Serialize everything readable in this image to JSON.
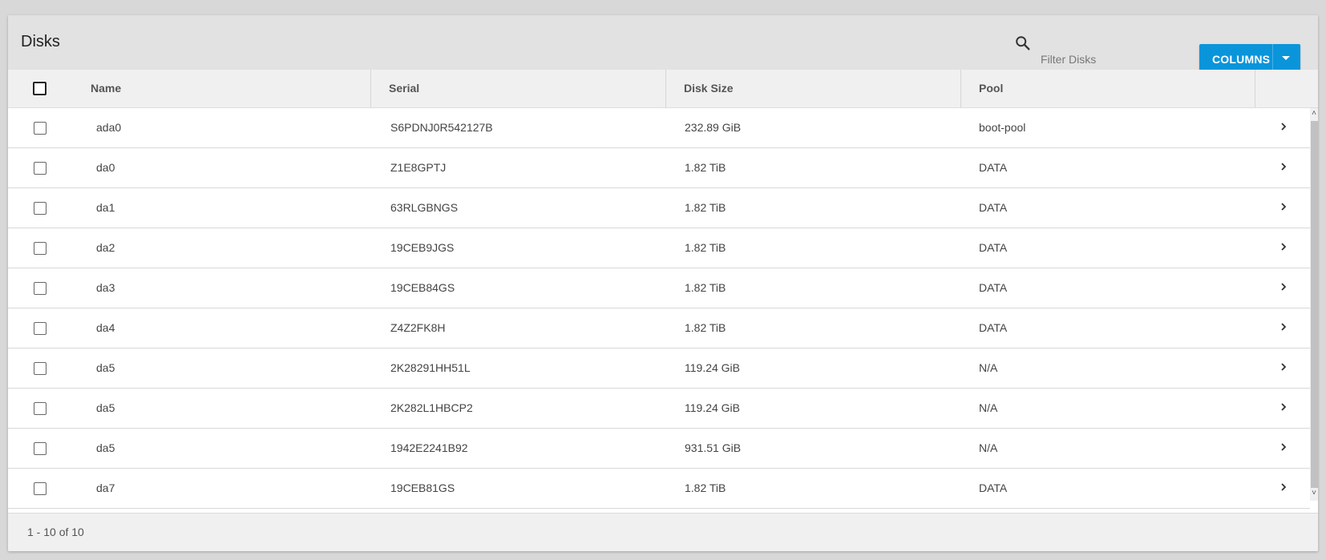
{
  "toolbar": {
    "title": "Disks",
    "search_icon": "search-icon",
    "filter_placeholder": "Filter Disks",
    "filter_value": "",
    "columns_label": "COLUMNS",
    "columns_caret_icon": "caret-down-icon",
    "accent_color": "#0a95db"
  },
  "table": {
    "headers": {
      "name": "Name",
      "serial": "Serial",
      "disk_size": "Disk Size",
      "pool": "Pool"
    },
    "rows": [
      {
        "name": "ada0",
        "serial": "S6PDNJ0R542127B",
        "disk_size": "232.89 GiB",
        "pool": "boot-pool"
      },
      {
        "name": "da0",
        "serial": "Z1E8GPTJ",
        "disk_size": "1.82 TiB",
        "pool": "DATA"
      },
      {
        "name": "da1",
        "serial": "63RLGBNGS",
        "disk_size": "1.82 TiB",
        "pool": "DATA"
      },
      {
        "name": "da2",
        "serial": "19CEB9JGS",
        "disk_size": "1.82 TiB",
        "pool": "DATA"
      },
      {
        "name": "da3",
        "serial": "19CEB84GS",
        "disk_size": "1.82 TiB",
        "pool": "DATA"
      },
      {
        "name": "da4",
        "serial": "Z4Z2FK8H",
        "disk_size": "1.82 TiB",
        "pool": "DATA"
      },
      {
        "name": "da5",
        "serial": "2K28291HH51L",
        "disk_size": "119.24 GiB",
        "pool": "N/A"
      },
      {
        "name": "da5",
        "serial": "2K282L1HBCP2",
        "disk_size": "119.24 GiB",
        "pool": "N/A"
      },
      {
        "name": "da5",
        "serial": "1942E2241B92",
        "disk_size": "931.51 GiB",
        "pool": "N/A"
      },
      {
        "name": "da7",
        "serial": "19CEB81GS",
        "disk_size": "1.82 TiB",
        "pool": "DATA"
      }
    ]
  },
  "footer": {
    "paginator": "1 - 10 of 10"
  }
}
